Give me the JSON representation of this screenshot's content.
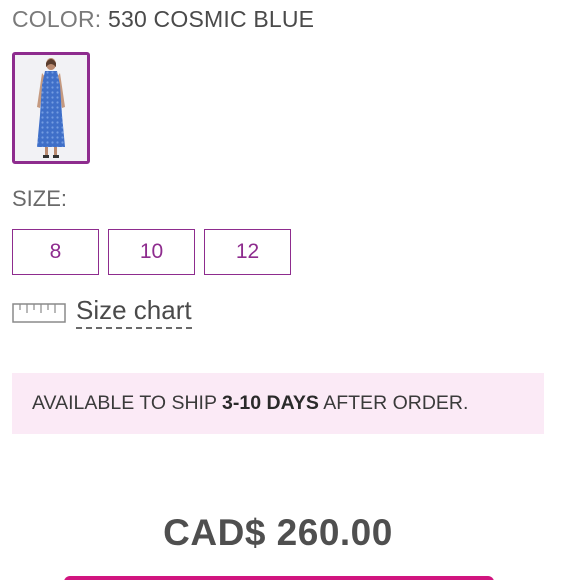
{
  "color": {
    "label": "COLOR:",
    "value": "530 COSMIC BLUE"
  },
  "swatch": {
    "icon": "dress-thumbnail",
    "accent": "#8e2c8e"
  },
  "size": {
    "title": "SIZE:",
    "options": [
      "8",
      "10",
      "12"
    ],
    "chart_label": "Size chart",
    "chart_icon": "ruler-icon"
  },
  "shipping": {
    "prefix": "AVAILABLE TO SHIP ",
    "emphasis": "3-10 DAYS",
    "suffix": " AFTER ORDER."
  },
  "price": {
    "text": "CAD$ 260.00"
  },
  "colors": {
    "accent": "#8e2c8e",
    "banner_bg": "#fbeaf6",
    "cta": "#d1157f"
  }
}
